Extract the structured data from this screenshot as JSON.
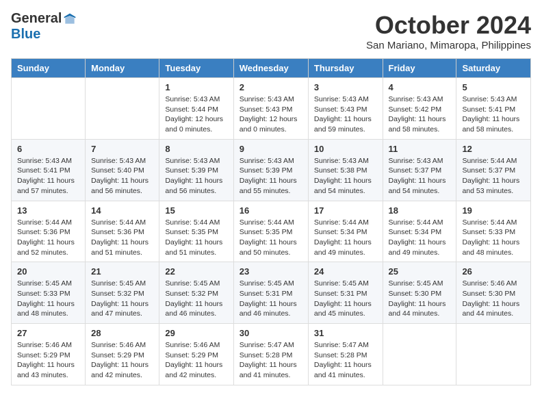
{
  "logo": {
    "general": "General",
    "blue": "Blue"
  },
  "title": {
    "month_year": "October 2024",
    "location": "San Mariano, Mimaropa, Philippines"
  },
  "headers": [
    "Sunday",
    "Monday",
    "Tuesday",
    "Wednesday",
    "Thursday",
    "Friday",
    "Saturday"
  ],
  "weeks": [
    [
      {
        "day": "",
        "info": ""
      },
      {
        "day": "",
        "info": ""
      },
      {
        "day": "1",
        "info": "Sunrise: 5:43 AM\nSunset: 5:44 PM\nDaylight: 12 hours\nand 0 minutes."
      },
      {
        "day": "2",
        "info": "Sunrise: 5:43 AM\nSunset: 5:43 PM\nDaylight: 12 hours\nand 0 minutes."
      },
      {
        "day": "3",
        "info": "Sunrise: 5:43 AM\nSunset: 5:43 PM\nDaylight: 11 hours\nand 59 minutes."
      },
      {
        "day": "4",
        "info": "Sunrise: 5:43 AM\nSunset: 5:42 PM\nDaylight: 11 hours\nand 58 minutes."
      },
      {
        "day": "5",
        "info": "Sunrise: 5:43 AM\nSunset: 5:41 PM\nDaylight: 11 hours\nand 58 minutes."
      }
    ],
    [
      {
        "day": "6",
        "info": "Sunrise: 5:43 AM\nSunset: 5:41 PM\nDaylight: 11 hours\nand 57 minutes."
      },
      {
        "day": "7",
        "info": "Sunrise: 5:43 AM\nSunset: 5:40 PM\nDaylight: 11 hours\nand 56 minutes."
      },
      {
        "day": "8",
        "info": "Sunrise: 5:43 AM\nSunset: 5:39 PM\nDaylight: 11 hours\nand 56 minutes."
      },
      {
        "day": "9",
        "info": "Sunrise: 5:43 AM\nSunset: 5:39 PM\nDaylight: 11 hours\nand 55 minutes."
      },
      {
        "day": "10",
        "info": "Sunrise: 5:43 AM\nSunset: 5:38 PM\nDaylight: 11 hours\nand 54 minutes."
      },
      {
        "day": "11",
        "info": "Sunrise: 5:43 AM\nSunset: 5:37 PM\nDaylight: 11 hours\nand 54 minutes."
      },
      {
        "day": "12",
        "info": "Sunrise: 5:44 AM\nSunset: 5:37 PM\nDaylight: 11 hours\nand 53 minutes."
      }
    ],
    [
      {
        "day": "13",
        "info": "Sunrise: 5:44 AM\nSunset: 5:36 PM\nDaylight: 11 hours\nand 52 minutes."
      },
      {
        "day": "14",
        "info": "Sunrise: 5:44 AM\nSunset: 5:36 PM\nDaylight: 11 hours\nand 51 minutes."
      },
      {
        "day": "15",
        "info": "Sunrise: 5:44 AM\nSunset: 5:35 PM\nDaylight: 11 hours\nand 51 minutes."
      },
      {
        "day": "16",
        "info": "Sunrise: 5:44 AM\nSunset: 5:35 PM\nDaylight: 11 hours\nand 50 minutes."
      },
      {
        "day": "17",
        "info": "Sunrise: 5:44 AM\nSunset: 5:34 PM\nDaylight: 11 hours\nand 49 minutes."
      },
      {
        "day": "18",
        "info": "Sunrise: 5:44 AM\nSunset: 5:34 PM\nDaylight: 11 hours\nand 49 minutes."
      },
      {
        "day": "19",
        "info": "Sunrise: 5:44 AM\nSunset: 5:33 PM\nDaylight: 11 hours\nand 48 minutes."
      }
    ],
    [
      {
        "day": "20",
        "info": "Sunrise: 5:45 AM\nSunset: 5:33 PM\nDaylight: 11 hours\nand 48 minutes."
      },
      {
        "day": "21",
        "info": "Sunrise: 5:45 AM\nSunset: 5:32 PM\nDaylight: 11 hours\nand 47 minutes."
      },
      {
        "day": "22",
        "info": "Sunrise: 5:45 AM\nSunset: 5:32 PM\nDaylight: 11 hours\nand 46 minutes."
      },
      {
        "day": "23",
        "info": "Sunrise: 5:45 AM\nSunset: 5:31 PM\nDaylight: 11 hours\nand 46 minutes."
      },
      {
        "day": "24",
        "info": "Sunrise: 5:45 AM\nSunset: 5:31 PM\nDaylight: 11 hours\nand 45 minutes."
      },
      {
        "day": "25",
        "info": "Sunrise: 5:45 AM\nSunset: 5:30 PM\nDaylight: 11 hours\nand 44 minutes."
      },
      {
        "day": "26",
        "info": "Sunrise: 5:46 AM\nSunset: 5:30 PM\nDaylight: 11 hours\nand 44 minutes."
      }
    ],
    [
      {
        "day": "27",
        "info": "Sunrise: 5:46 AM\nSunset: 5:29 PM\nDaylight: 11 hours\nand 43 minutes."
      },
      {
        "day": "28",
        "info": "Sunrise: 5:46 AM\nSunset: 5:29 PM\nDaylight: 11 hours\nand 42 minutes."
      },
      {
        "day": "29",
        "info": "Sunrise: 5:46 AM\nSunset: 5:29 PM\nDaylight: 11 hours\nand 42 minutes."
      },
      {
        "day": "30",
        "info": "Sunrise: 5:47 AM\nSunset: 5:28 PM\nDaylight: 11 hours\nand 41 minutes."
      },
      {
        "day": "31",
        "info": "Sunrise: 5:47 AM\nSunset: 5:28 PM\nDaylight: 11 hours\nand 41 minutes."
      },
      {
        "day": "",
        "info": ""
      },
      {
        "day": "",
        "info": ""
      }
    ]
  ]
}
